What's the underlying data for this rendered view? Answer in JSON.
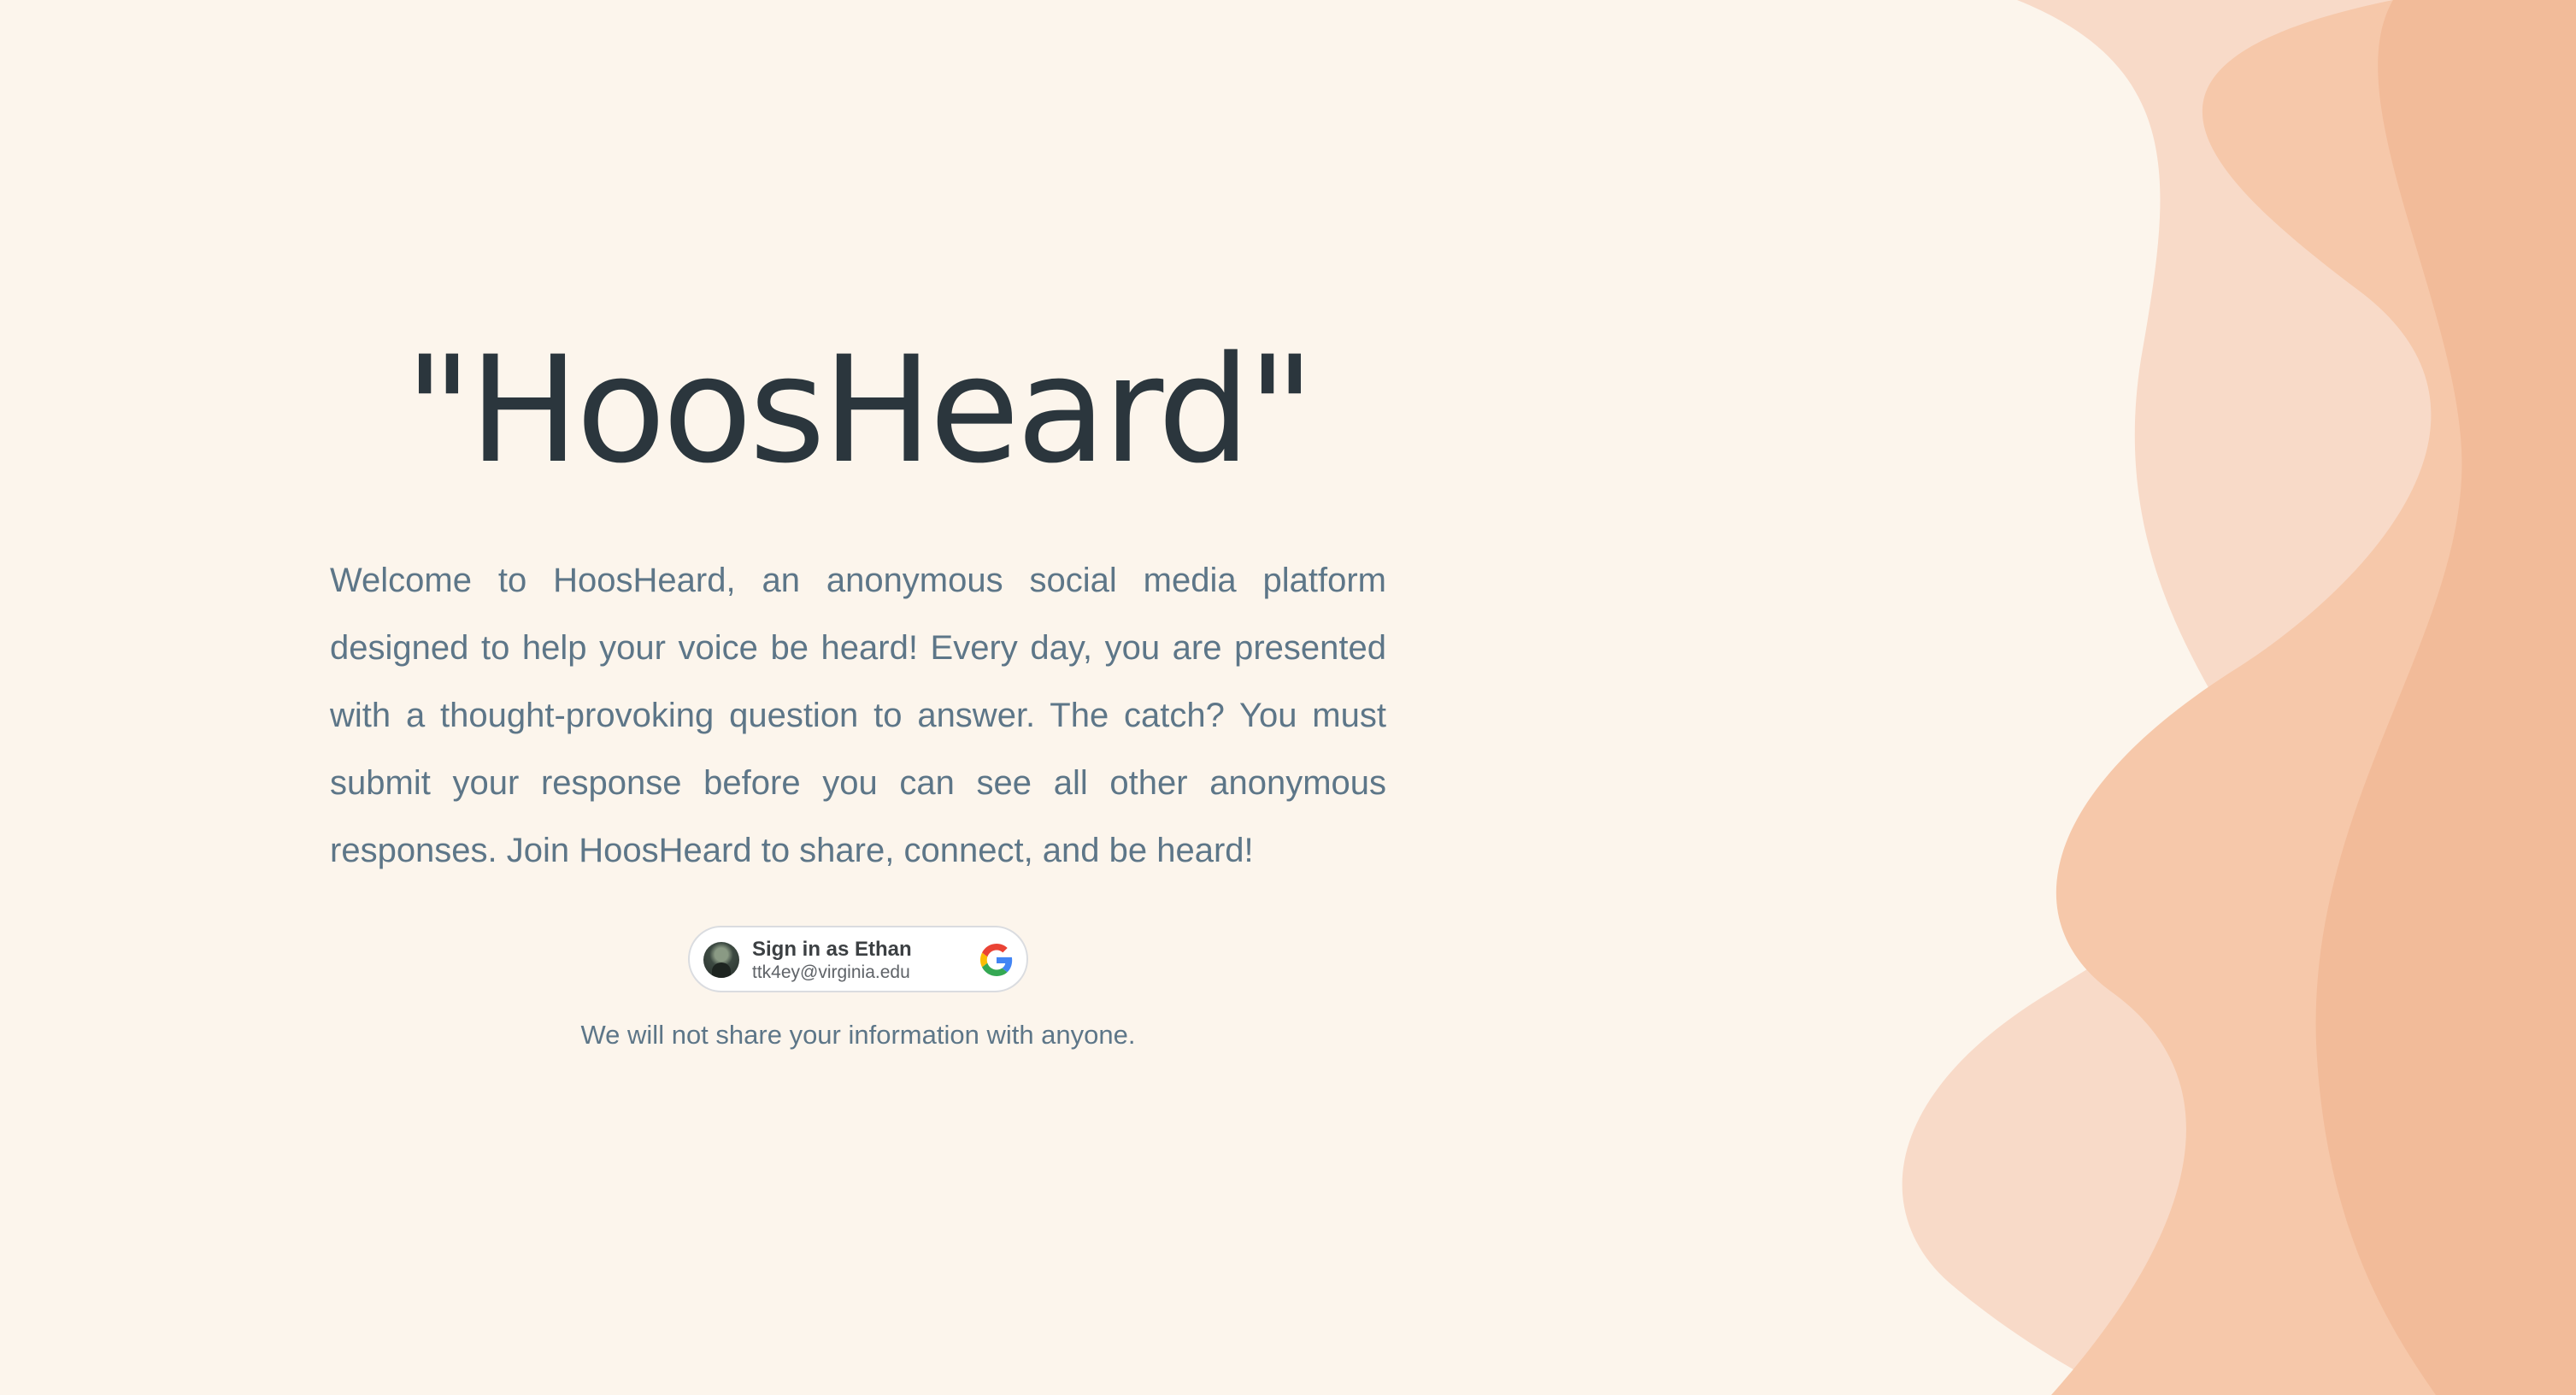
{
  "brand": {
    "title": "\"HoosHeard\""
  },
  "intro": {
    "text": "Welcome to HoosHeard, an anonymous social media platform designed to help your voice be heard! Every day, you are presented with a thought-provoking question to answer. The catch? You must submit your response before you can see all other anonymous responses. Join HoosHeard to share, connect, and be heard!"
  },
  "signin": {
    "title": "Sign in as Ethan",
    "email": "ttk4ey@virginia.edu",
    "avatar_icon": "user-avatar",
    "provider_icon": "google-g-icon"
  },
  "disclaimer": {
    "text": "We will not share your information with anyone."
  },
  "colors": {
    "background": "#fcf5ec",
    "wave_light": "#f8dac8",
    "wave_mid": "#f6c8aa",
    "wave_dark": "#f2bb99",
    "heading": "#2b363d",
    "body_text": "#5d7688"
  }
}
